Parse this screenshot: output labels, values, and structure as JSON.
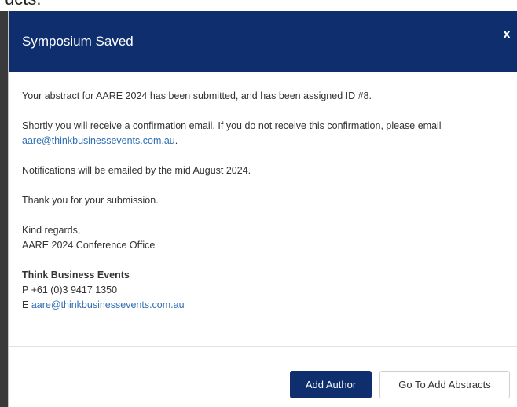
{
  "background": {
    "partial_text": "ucts."
  },
  "modal": {
    "title": "Symposium Saved",
    "close_label": "x",
    "body": {
      "line1": "Your abstract for AARE 2024 has been submitted, and has been assigned ID #8.",
      "line2_prefix": "Shortly you will receive a confirmation email.  If you do not receive this confirmation, please email ",
      "line2_email": "aare@thinkbusinessevents.com.au",
      "line2_suffix": ".",
      "line3": "Notifications will be emailed by the mid August 2024.",
      "line4": "Thank you for your submission.",
      "closing": "Kind regards,",
      "office": "AARE 2024 Conference Office",
      "org_name": "Think Business Events",
      "phone": "P +61 (0)3 9417 1350",
      "email_prefix": "E ",
      "email": "aare@thinkbusinessevents.com.au"
    },
    "footer": {
      "add_author_label": "Add Author",
      "go_to_abstracts_label": "Go To Add Abstracts"
    }
  },
  "colors": {
    "header_bg": "#0e2e6e",
    "link": "#2f6fb5",
    "primary_button": "#0e2e6e"
  }
}
